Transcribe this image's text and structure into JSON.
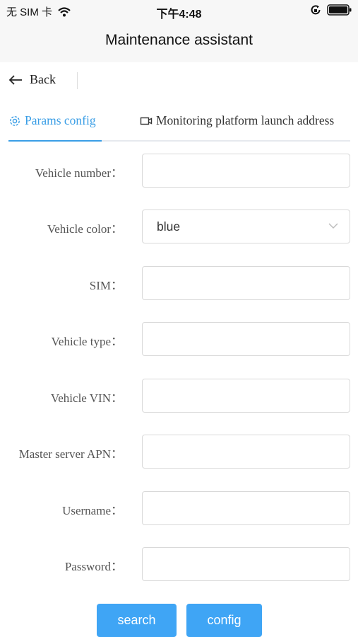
{
  "status_bar": {
    "carrier": "无 SIM 卡",
    "time": "下午4:48"
  },
  "nav": {
    "title": "Maintenance assistant"
  },
  "back": {
    "label": "Back"
  },
  "tabs": [
    {
      "label": "Params config",
      "icon": "gear-icon",
      "active": true
    },
    {
      "label": "Monitoring platform launch address",
      "icon": "video-camera-icon",
      "active": false
    }
  ],
  "form": {
    "fields": [
      {
        "label": "Vehicle number：",
        "value": ""
      },
      {
        "label": "Vehicle color：",
        "value": "blue",
        "type": "select"
      },
      {
        "label": "SIM：",
        "value": ""
      },
      {
        "label": "Vehicle type：",
        "value": ""
      },
      {
        "label": "Vehicle VIN：",
        "value": ""
      },
      {
        "label": "Master server APN：",
        "value": ""
      },
      {
        "label": "Username：",
        "value": ""
      },
      {
        "label": "Password：",
        "value": ""
      }
    ]
  },
  "buttons": {
    "search": "search",
    "config": "config"
  },
  "colors": {
    "accent": "#3a9ee6",
    "button": "#3fa5f5",
    "bar_bg": "#f7f7f7"
  }
}
